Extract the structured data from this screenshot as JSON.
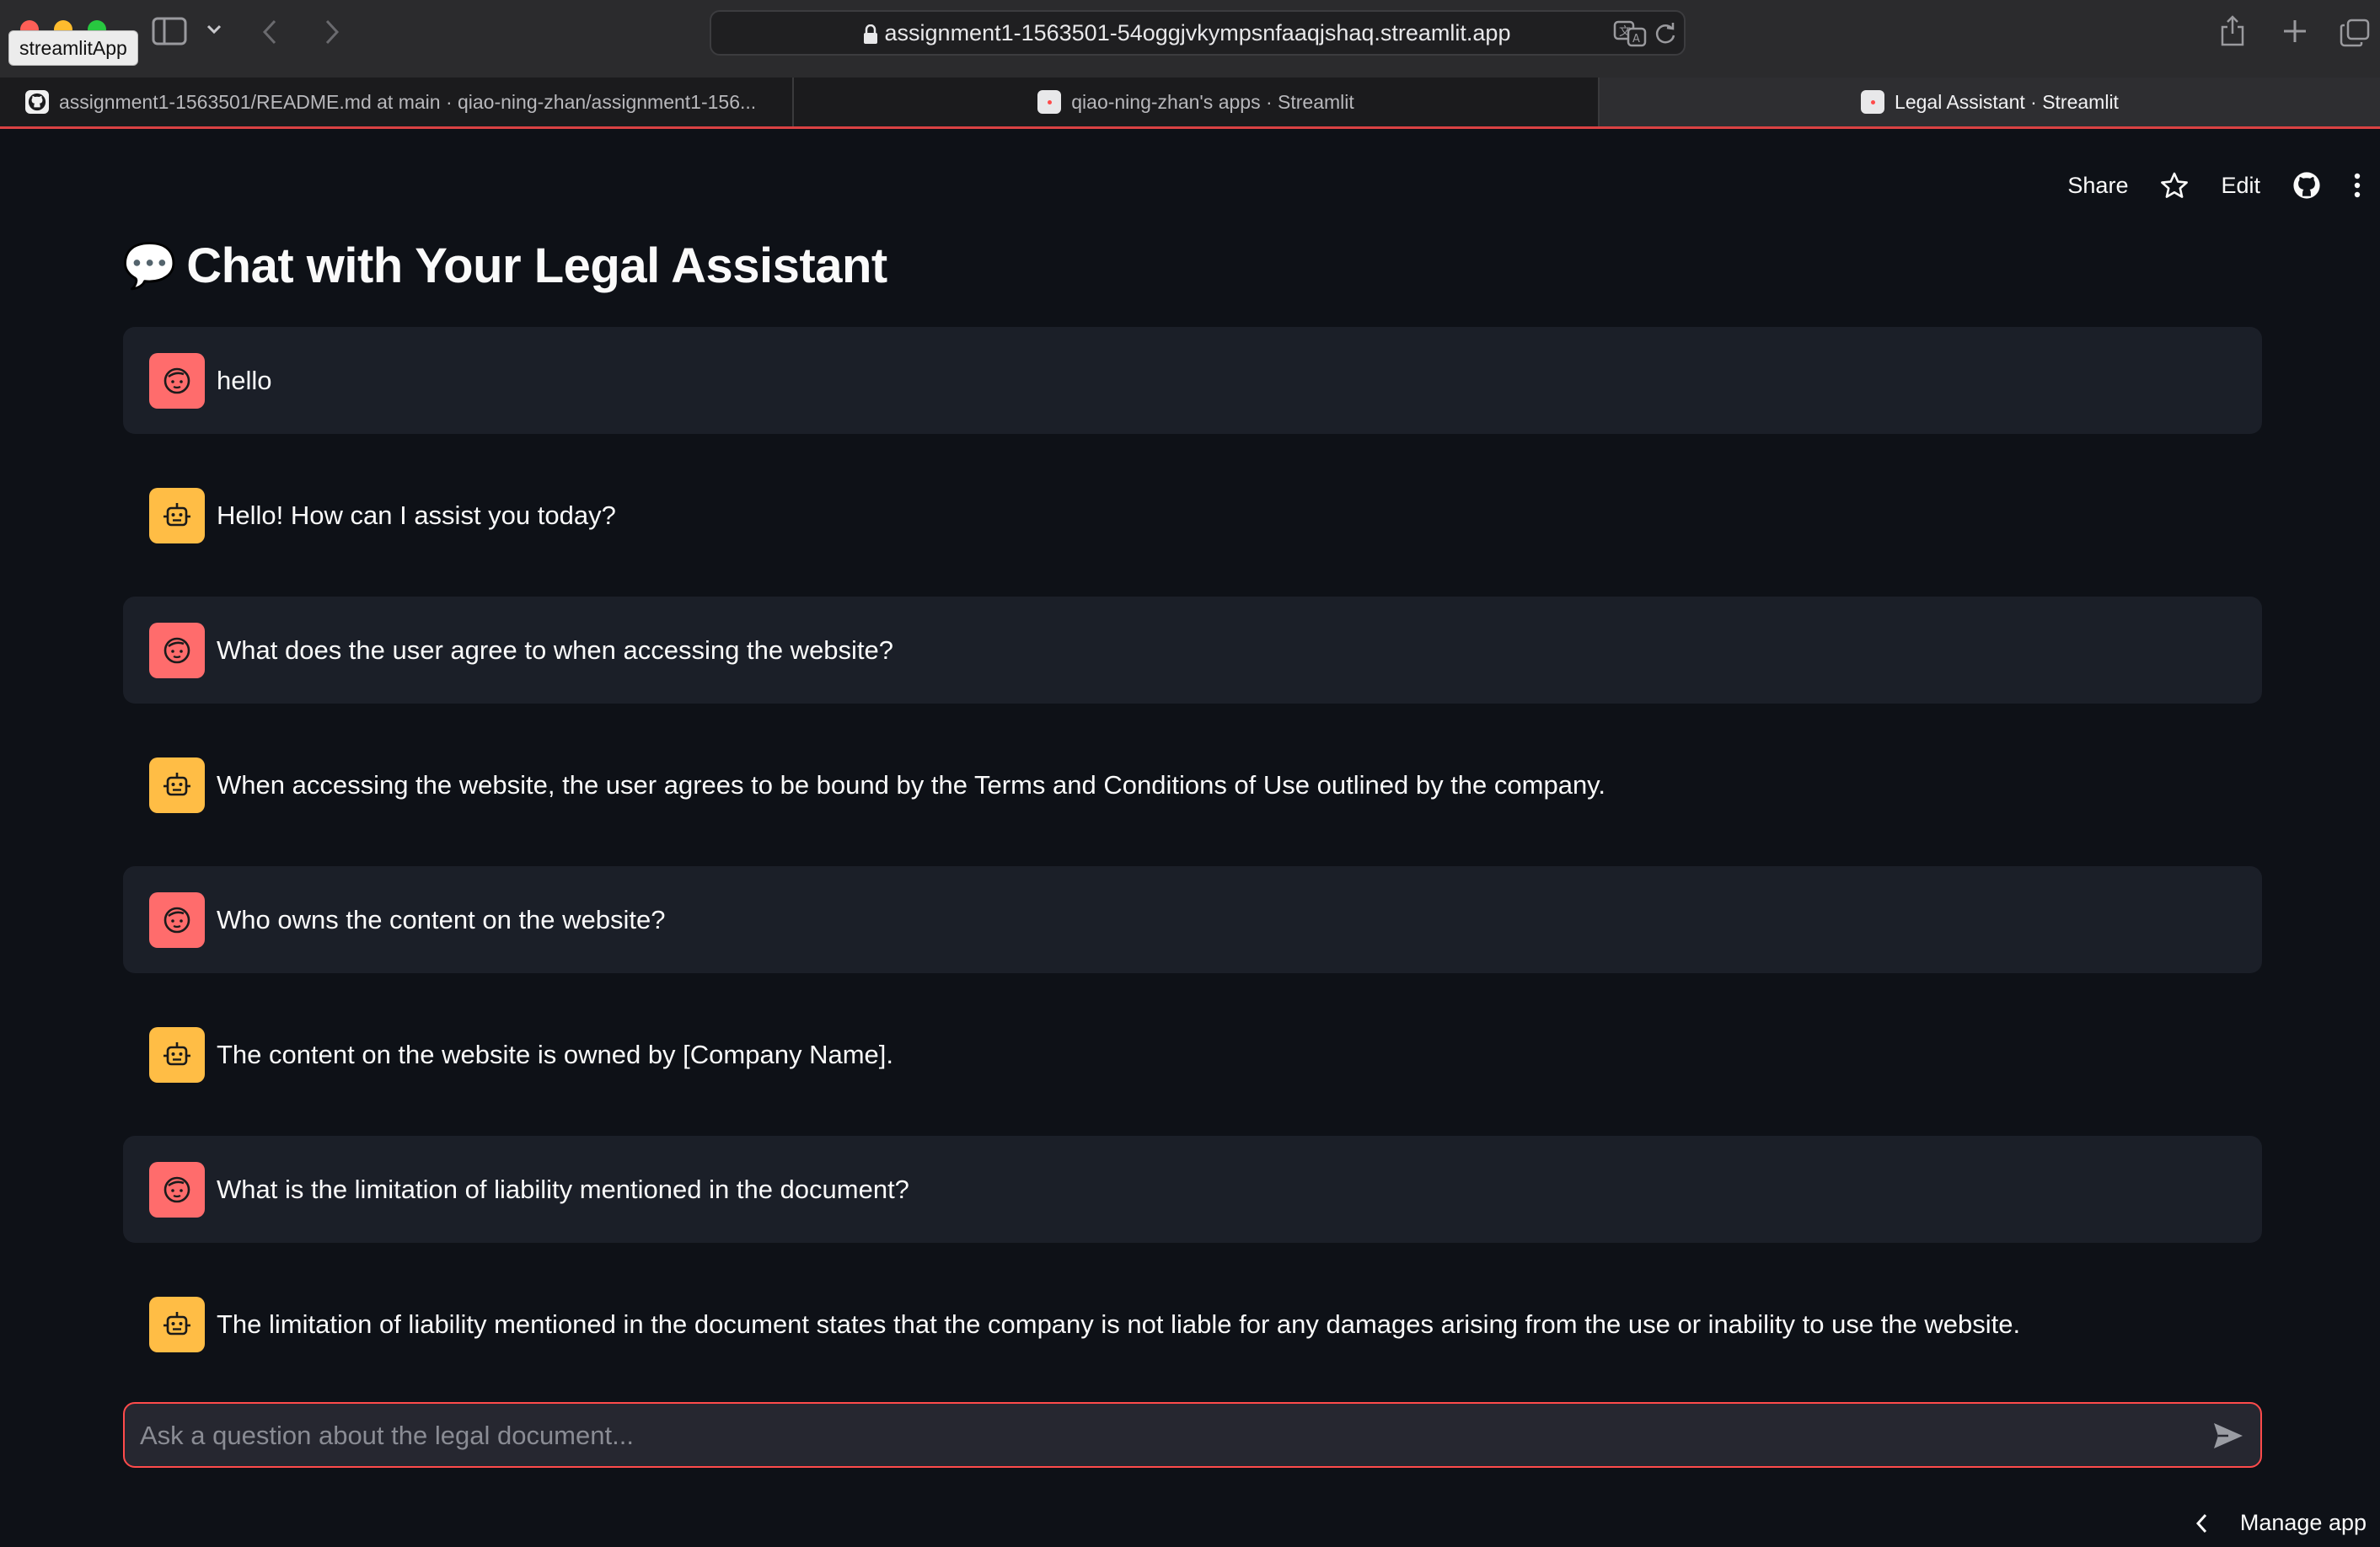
{
  "window": {
    "app_tooltip": "streamlitApp",
    "url": "assignment1-1563501-54oggjvkympsnfaaqjshaq.streamlit.app"
  },
  "tabs": [
    {
      "label": "assignment1-1563501/README.md at main · qiao-ning-zhan/assignment1-156...",
      "favicon": "github-icon",
      "active": false
    },
    {
      "label": "qiao-ning-zhan's apps · Streamlit",
      "favicon": "streamlit-favicon",
      "active": false
    },
    {
      "label": "Legal Assistant · Streamlit",
      "favicon": "streamlit-favicon",
      "active": true
    }
  ],
  "toolbar": {
    "share_label": "Share",
    "edit_label": "Edit"
  },
  "page": {
    "title_emoji": "💬",
    "title": "Chat with Your Legal Assistant"
  },
  "messages": [
    {
      "role": "user",
      "text": "hello"
    },
    {
      "role": "assistant",
      "text": "Hello! How can I assist you today?"
    },
    {
      "role": "user",
      "text": "What does the user agree to when accessing the website?"
    },
    {
      "role": "assistant",
      "text": "When accessing the website, the user agrees to be bound by the Terms and Conditions of Use outlined by the company."
    },
    {
      "role": "user",
      "text": "Who owns the content on the website?"
    },
    {
      "role": "assistant",
      "text": "The content on the website is owned by [Company Name]."
    },
    {
      "role": "user",
      "text": "What is the limitation of liability mentioned in the document?"
    },
    {
      "role": "assistant",
      "text": "The limitation of liability mentioned in the document states that the company is not liable for any damages arising from the use or inability to use the website."
    }
  ],
  "chat_input": {
    "placeholder": "Ask a question about the legal document...",
    "value": ""
  },
  "footer": {
    "manage_label": "Manage app"
  },
  "colors": {
    "background": "#0e1117",
    "user_bubble": "#1b1f28",
    "user_avatar": "#ff6c6c",
    "assistant_avatar": "#ffbd45",
    "accent": "#ff4b4b"
  }
}
